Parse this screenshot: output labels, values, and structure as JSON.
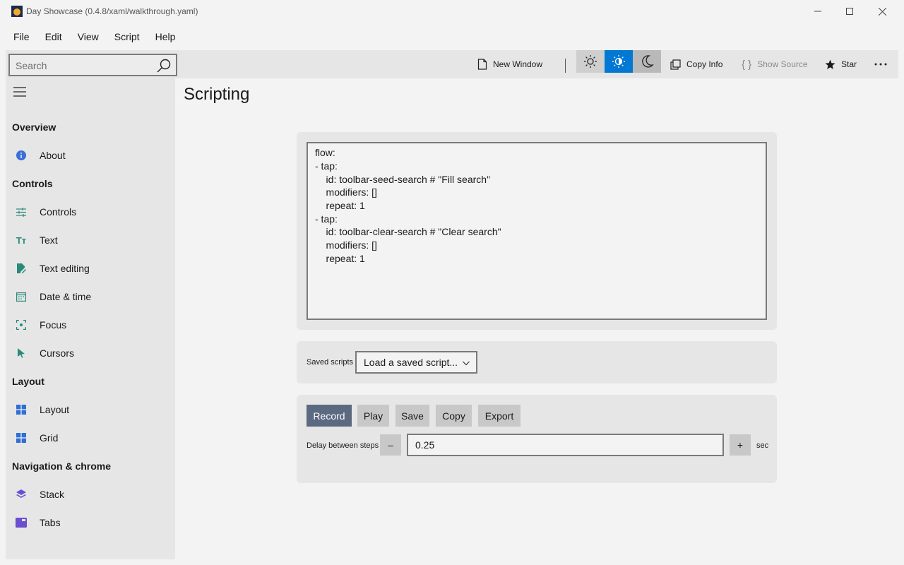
{
  "window": {
    "title": "Day Showcase (0.4.8/xaml/walkthrough.yaml)"
  },
  "menu": {
    "items": [
      "File",
      "Edit",
      "View",
      "Script",
      "Help"
    ]
  },
  "toolbar": {
    "search_placeholder": "Search",
    "new_window": "New Window",
    "copy_info": "Copy Info",
    "show_source": "Show Source",
    "star": "Star",
    "accent": "#0078d4"
  },
  "sidebar": {
    "sections": [
      {
        "title": "Overview",
        "items": [
          {
            "label": "About",
            "icon": "info-icon"
          }
        ]
      },
      {
        "title": "Controls",
        "items": [
          {
            "label": "Controls",
            "icon": "sliders-icon"
          },
          {
            "label": "Text",
            "icon": "text-size-icon"
          },
          {
            "label": "Text editing",
            "icon": "document-edit-icon"
          },
          {
            "label": "Date & time",
            "icon": "calendar-icon"
          },
          {
            "label": "Focus",
            "icon": "focus-icon"
          },
          {
            "label": "Cursors",
            "icon": "cursor-icon"
          }
        ]
      },
      {
        "title": "Layout",
        "items": [
          {
            "label": "Layout",
            "icon": "layout-icon"
          },
          {
            "label": "Grid",
            "icon": "grid-icon"
          }
        ]
      },
      {
        "title": "Navigation & chrome",
        "items": [
          {
            "label": "Stack",
            "icon": "stack-icon"
          },
          {
            "label": "Tabs",
            "icon": "tabs-icon"
          }
        ]
      }
    ]
  },
  "main": {
    "title": "Scripting",
    "script_lines": [
      "flow:",
      "- tap:",
      "    id: toolbar-seed-search # \"Fill search\"",
      "    modifiers: []",
      "    repeat: 1",
      "- tap:",
      "    id: toolbar-clear-search # \"Clear search\"",
      "    modifiers: []",
      "    repeat: 1"
    ],
    "saved_scripts_label": "Saved scripts",
    "saved_scripts_selected": "Load a saved script...",
    "buttons": {
      "record": "Record",
      "play": "Play",
      "save": "Save",
      "copy": "Copy",
      "export": "Export"
    },
    "delay_label": "Delay between steps",
    "delay_minus": "–",
    "delay_value": "0.25",
    "delay_plus": "+",
    "delay_unit": "sec"
  }
}
